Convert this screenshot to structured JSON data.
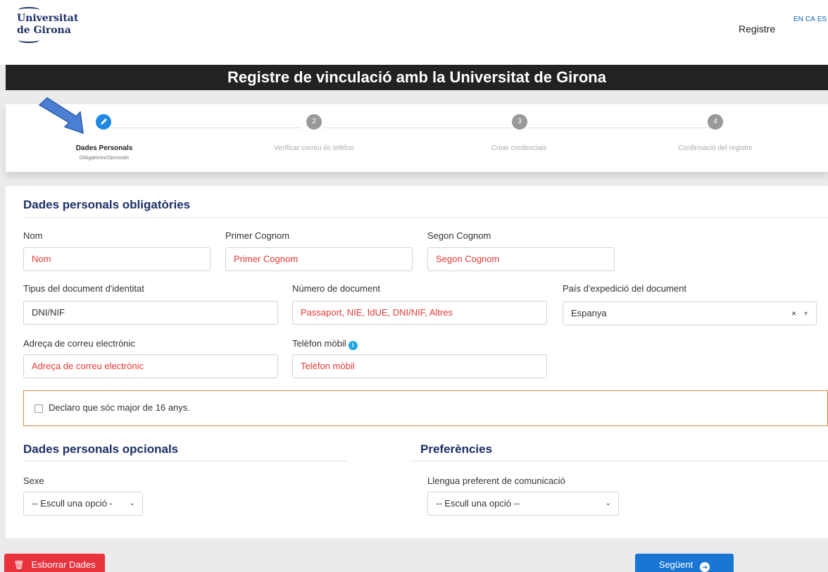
{
  "header": {
    "logo_line1": "Universitat",
    "logo_line2": "de Girona",
    "registre_link": "Registre",
    "languages": [
      "EN",
      "CA",
      "ES"
    ]
  },
  "title": "Registre de vinculació amb la Universitat de Girona",
  "stepper": {
    "steps": [
      {
        "number": "",
        "label": "Dades Personals",
        "sub": "Obligatòries/Opcionals",
        "active": true
      },
      {
        "number": "2",
        "label": "Verificar correu i/o telèfon",
        "sub": "",
        "active": false
      },
      {
        "number": "3",
        "label": "Crear credencials",
        "sub": "",
        "active": false
      },
      {
        "number": "4",
        "label": "Confirmació del registre",
        "sub": "",
        "active": false
      }
    ]
  },
  "mandatory": {
    "heading": "Dades personals obligatòries",
    "nom_label": "Nom",
    "nom_placeholder": "Nom",
    "cognom1_label": "Primer Cognom",
    "cognom1_placeholder": "Primer Cognom",
    "cognom2_label": "Segon Cognom",
    "cognom2_placeholder": "Segon Cognom",
    "doc_type_label": "Tipus del document d'identitat",
    "doc_type_value": "DNI/NIF",
    "doc_number_label": "Número de document",
    "doc_number_placeholder": "Passaport, NIE, IdUE, DNI/NIF, Altres",
    "country_label": "País d'expedició del document",
    "country_value": "Espanya",
    "email_label": "Adreça de correu electrònic",
    "email_placeholder": "Adreça de correu electrònic",
    "phone_label": "Telèfon mòbil",
    "phone_placeholder": "Telèfon mòbil",
    "declare_text": "Declaro que sóc major de 16 anys."
  },
  "optional": {
    "heading": "Dades personals opcionals",
    "sexe_label": "Sexe",
    "sexe_value": "-- Escull una opció -"
  },
  "preferences": {
    "heading": "Preferències",
    "lang_label": "Llengua preferent de comunicació",
    "lang_value": "-- Escull una opció --"
  },
  "buttons": {
    "delete": "Esborrar Dades",
    "next": "Següent"
  },
  "colors": {
    "accent": "#1976d2",
    "danger": "#e8323c",
    "heading": "#1b2f66",
    "placeholder_red": "#e53935"
  }
}
